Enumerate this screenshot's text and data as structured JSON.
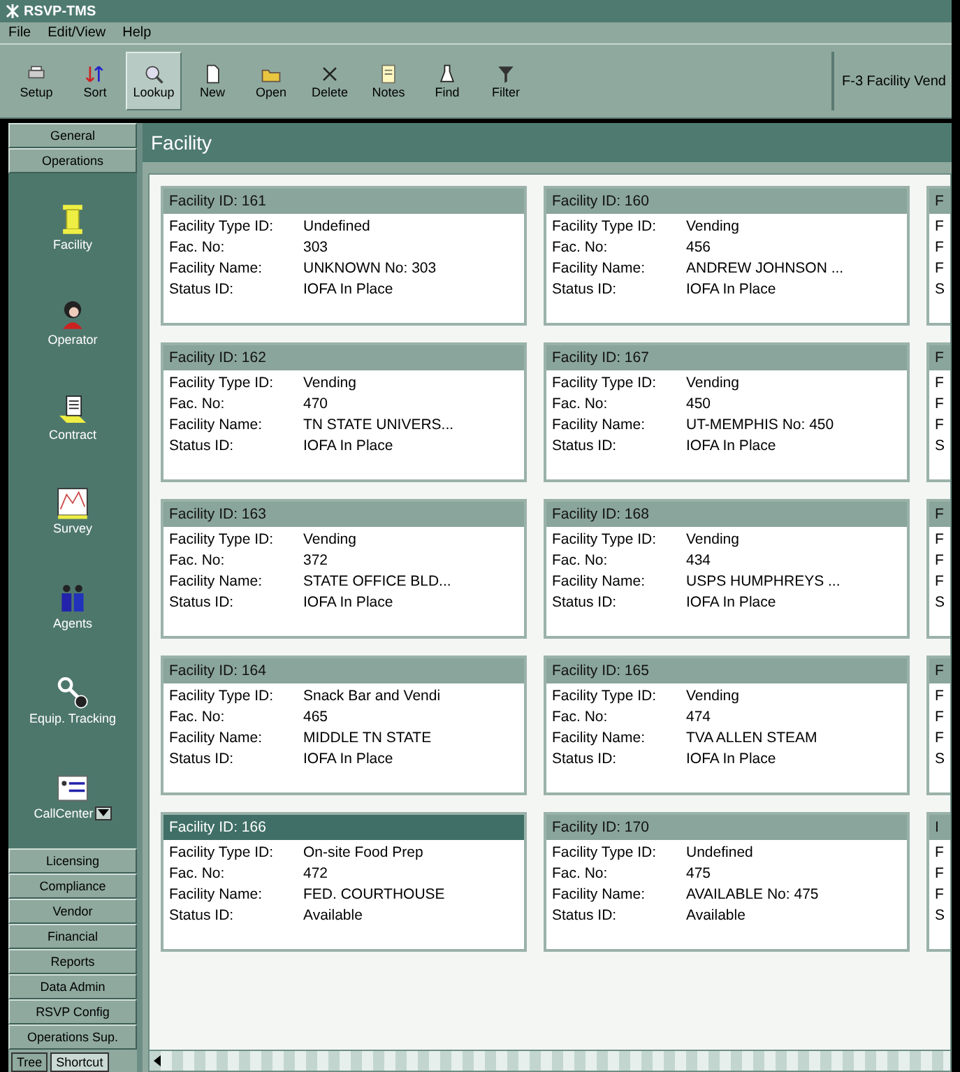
{
  "window": {
    "title": "RSVP-TMS"
  },
  "menu": [
    "File",
    "Edit/View",
    "Help"
  ],
  "toolbar": [
    {
      "label": "Setup",
      "selected": false
    },
    {
      "label": "Sort",
      "selected": false
    },
    {
      "label": "Lookup",
      "selected": true
    },
    {
      "label": "New",
      "selected": false
    },
    {
      "label": "Open",
      "selected": false
    },
    {
      "label": "Delete",
      "selected": false
    },
    {
      "label": "Notes",
      "selected": false
    },
    {
      "label": "Find",
      "selected": false
    },
    {
      "label": "Filter",
      "selected": false
    }
  ],
  "toolbar_text": "F-3 Facility Vend",
  "sidebar": {
    "top_buttons": [
      "General",
      "Operations"
    ],
    "items": [
      {
        "label": "Facility"
      },
      {
        "label": "Operator"
      },
      {
        "label": "Contract"
      },
      {
        "label": "Survey"
      },
      {
        "label": "Agents"
      },
      {
        "label": "Equip. Tracking"
      },
      {
        "label": "CallCenter"
      }
    ],
    "bottom_buttons": [
      "Licensing",
      "Compliance",
      "Vendor",
      "Financial",
      "Reports",
      "Data Admin",
      "RSVP Config",
      "Operations Sup."
    ],
    "tabs": [
      {
        "label": "Tree",
        "selected": false
      },
      {
        "label": "Shortcut",
        "selected": true
      }
    ]
  },
  "panel_title": "Facility",
  "cards": [
    {
      "kind": "full",
      "title": "Facility ID: 161",
      "selected": false,
      "rows": [
        {
          "label": "Facility Type ID:",
          "value": "Undefined"
        },
        {
          "label": "Fac. No:",
          "value": "303"
        },
        {
          "label": "Facility Name:",
          "value": "UNKNOWN No: 303"
        },
        {
          "label": "Status ID:",
          "value": "IOFA In Place"
        }
      ]
    },
    {
      "kind": "full",
      "title": "Facility ID: 160",
      "selected": false,
      "rows": [
        {
          "label": "Facility Type ID:",
          "value": "Vending"
        },
        {
          "label": "Fac. No:",
          "value": "456"
        },
        {
          "label": "Facility Name:",
          "value": "ANDREW JOHNSON ..."
        },
        {
          "label": "Status ID:",
          "value": "IOFA In Place"
        }
      ]
    },
    {
      "kind": "partial",
      "title": "F",
      "selected": false,
      "rows": [
        {
          "label": "F"
        },
        {
          "label": "F"
        },
        {
          "label": "F"
        },
        {
          "label": "S"
        }
      ]
    },
    {
      "kind": "full",
      "title": "Facility ID: 162",
      "selected": false,
      "rows": [
        {
          "label": "Facility Type ID:",
          "value": "Vending"
        },
        {
          "label": "Fac. No:",
          "value": "470"
        },
        {
          "label": "Facility Name:",
          "value": "TN STATE UNIVERS..."
        },
        {
          "label": "Status ID:",
          "value": "IOFA In Place"
        }
      ]
    },
    {
      "kind": "full",
      "title": "Facility ID: 167",
      "selected": false,
      "rows": [
        {
          "label": "Facility Type ID:",
          "value": "Vending"
        },
        {
          "label": "Fac. No:",
          "value": "450"
        },
        {
          "label": "Facility Name:",
          "value": "UT-MEMPHIS No: 450"
        },
        {
          "label": "Status ID:",
          "value": "IOFA In Place"
        }
      ]
    },
    {
      "kind": "partial",
      "title": "F",
      "selected": false,
      "rows": [
        {
          "label": "F"
        },
        {
          "label": "F"
        },
        {
          "label": "F"
        },
        {
          "label": "S"
        }
      ]
    },
    {
      "kind": "full",
      "title": "Facility ID: 163",
      "selected": false,
      "rows": [
        {
          "label": "Facility Type ID:",
          "value": "Vending"
        },
        {
          "label": "Fac. No:",
          "value": "372"
        },
        {
          "label": "Facility Name:",
          "value": "STATE OFFICE BLD..."
        },
        {
          "label": "Status ID:",
          "value": "IOFA In Place"
        }
      ]
    },
    {
      "kind": "full",
      "title": "Facility ID: 168",
      "selected": false,
      "rows": [
        {
          "label": "Facility Type ID:",
          "value": "Vending"
        },
        {
          "label": "Fac. No:",
          "value": "434"
        },
        {
          "label": "Facility Name:",
          "value": "USPS HUMPHREYS ..."
        },
        {
          "label": "Status ID:",
          "value": "IOFA In Place"
        }
      ]
    },
    {
      "kind": "partial",
      "title": "F",
      "selected": false,
      "rows": [
        {
          "label": "F"
        },
        {
          "label": "F"
        },
        {
          "label": "F"
        },
        {
          "label": "S"
        }
      ]
    },
    {
      "kind": "full",
      "title": "Facility ID: 164",
      "selected": false,
      "rows": [
        {
          "label": "Facility Type ID:",
          "value": "Snack Bar and Vendi"
        },
        {
          "label": "Fac. No:",
          "value": "465"
        },
        {
          "label": "Facility Name:",
          "value": "MIDDLE TN STATE"
        },
        {
          "label": "Status ID:",
          "value": "IOFA In Place"
        }
      ]
    },
    {
      "kind": "full",
      "title": "Facility ID: 165",
      "selected": false,
      "rows": [
        {
          "label": "Facility Type ID:",
          "value": "Vending"
        },
        {
          "label": "Fac. No:",
          "value": "474"
        },
        {
          "label": "Facility Name:",
          "value": "TVA ALLEN STEAM"
        },
        {
          "label": "Status ID:",
          "value": "IOFA In Place"
        }
      ]
    },
    {
      "kind": "partial",
      "title": "F",
      "selected": false,
      "rows": [
        {
          "label": "F"
        },
        {
          "label": "F"
        },
        {
          "label": "F"
        },
        {
          "label": "S"
        }
      ]
    },
    {
      "kind": "full",
      "title": "Facility ID: 166",
      "selected": true,
      "rows": [
        {
          "label": "Facility Type ID:",
          "value": "On-site Food Prep"
        },
        {
          "label": "Fac. No:",
          "value": "472"
        },
        {
          "label": "Facility Name:",
          "value": "FED. COURTHOUSE"
        },
        {
          "label": "Status ID:",
          "value": "Available"
        }
      ]
    },
    {
      "kind": "full",
      "title": "Facility ID: 170",
      "selected": false,
      "rows": [
        {
          "label": "Facility Type ID:",
          "value": "Undefined"
        },
        {
          "label": "Fac. No:",
          "value": "475"
        },
        {
          "label": "Facility Name:",
          "value": "AVAILABLE No: 475"
        },
        {
          "label": "Status ID:",
          "value": "Available"
        }
      ]
    },
    {
      "kind": "partial",
      "title": "I",
      "selected": false,
      "rows": [
        {
          "label": "F"
        },
        {
          "label": "F"
        },
        {
          "label": "F"
        },
        {
          "label": "S"
        }
      ]
    }
  ]
}
